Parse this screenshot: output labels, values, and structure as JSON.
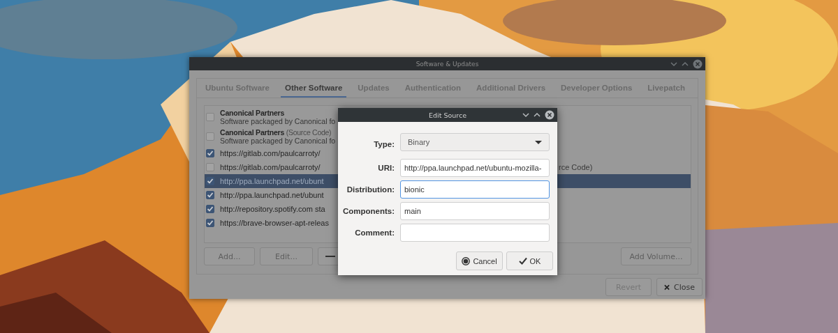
{
  "main_window": {
    "title": "Software & Updates",
    "tabs": [
      {
        "label": "Ubuntu Software",
        "selected": false
      },
      {
        "label": "Other Software",
        "selected": true
      },
      {
        "label": "Updates",
        "selected": false
      },
      {
        "label": "Authentication",
        "selected": false
      },
      {
        "label": "Additional Drivers",
        "selected": false
      },
      {
        "label": "Developer Options",
        "selected": false
      },
      {
        "label": "Livepatch",
        "selected": false
      }
    ],
    "sources": [
      {
        "kind": "partner",
        "title": "Canonical Partners",
        "subtitle": "Software packaged by Canonical fo",
        "checked": false,
        "selected": false
      },
      {
        "kind": "partner",
        "title": "Canonical Partners",
        "note": "(Source Code)",
        "subtitle": "Software packaged by Canonical fo",
        "checked": false,
        "selected": false
      },
      {
        "kind": "url",
        "title": "https://gitlab.com/paulcarroty/",
        "checked": true,
        "selected": false
      },
      {
        "kind": "url",
        "title": "https://gitlab.com/paulcarroty/",
        "tail": "rce Code)",
        "checked": false,
        "selected": false
      },
      {
        "kind": "url",
        "title": "http://ppa.launchpad.net/ubunt",
        "checked": true,
        "selected": true
      },
      {
        "kind": "url",
        "title": "http://ppa.launchpad.net/ubunt",
        "checked": true,
        "selected": false
      },
      {
        "kind": "url",
        "title": "http://repository.spotify.com sta",
        "checked": true,
        "selected": false
      },
      {
        "kind": "url",
        "title": "https://brave-browser-apt-releas",
        "checked": true,
        "selected": false
      }
    ],
    "list_buttons": [
      {
        "label": "Add..."
      },
      {
        "label": "Edit..."
      },
      {
        "kind": "minus"
      }
    ],
    "volume_button": {
      "label": "Add Volume..."
    },
    "footer_buttons": [
      {
        "label": "Revert",
        "disabled": true
      },
      {
        "label": "Close",
        "disabled": false,
        "kind": "close"
      }
    ]
  },
  "dialog": {
    "title": "Edit Source",
    "fields": [
      {
        "label": "Type:",
        "kind": "combo",
        "value": "Binary"
      },
      {
        "label": "URI:",
        "kind": "text",
        "value": "http://ppa.launchpad.net/ubuntu-mozilla-",
        "focused": false
      },
      {
        "label": "Distribution:",
        "kind": "text",
        "value": "bionic",
        "focused": true
      },
      {
        "label": "Components:",
        "kind": "text",
        "value": "main",
        "focused": false
      },
      {
        "label": "Comment:",
        "kind": "text",
        "focused": false
      }
    ],
    "buttons": [
      {
        "label": "Cancel",
        "kind": "cancel"
      },
      {
        "label": "OK",
        "kind": "confirm"
      }
    ]
  }
}
